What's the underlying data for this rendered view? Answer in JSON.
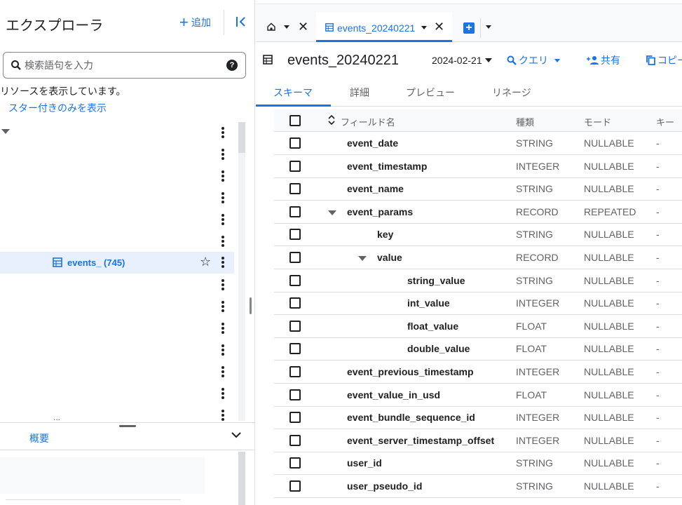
{
  "explorer": {
    "title": "エクスプローラ",
    "add_label": "追加",
    "search_placeholder": "検索語句を入力",
    "resource_note": "リソースを表示しています。",
    "starred_link": "スター付きのみを表示",
    "selected_item": "events_ (745)",
    "tree_ellipsis": "...",
    "summary_label": "概要"
  },
  "tabs": {
    "active_label": "events_20240221"
  },
  "table": {
    "title": "events_20240221",
    "date": "2024-02-21",
    "query_label": "クエリ",
    "share_label": "共有",
    "copy_label": "コピー"
  },
  "subtabs": [
    "スキーマ",
    "詳細",
    "プレビュー",
    "リネージ"
  ],
  "schema_headers": {
    "field_name": "フィールド名",
    "type": "種類",
    "mode": "モード",
    "key": "キー"
  },
  "schema_rows": [
    {
      "name": "event_date",
      "type": "STRING",
      "mode": "NULLABLE",
      "key": "-"
    },
    {
      "name": "event_timestamp",
      "type": "INTEGER",
      "mode": "NULLABLE",
      "key": "-"
    },
    {
      "name": "event_name",
      "type": "STRING",
      "mode": "NULLABLE",
      "key": "-"
    },
    {
      "name": "event_params",
      "type": "RECORD",
      "mode": "REPEATED",
      "key": "-"
    },
    {
      "name": "key",
      "type": "STRING",
      "mode": "NULLABLE",
      "key": "-"
    },
    {
      "name": "value",
      "type": "RECORD",
      "mode": "NULLABLE",
      "key": "-"
    },
    {
      "name": "string_value",
      "type": "STRING",
      "mode": "NULLABLE",
      "key": "-"
    },
    {
      "name": "int_value",
      "type": "INTEGER",
      "mode": "NULLABLE",
      "key": "-"
    },
    {
      "name": "float_value",
      "type": "FLOAT",
      "mode": "NULLABLE",
      "key": "-"
    },
    {
      "name": "double_value",
      "type": "FLOAT",
      "mode": "NULLABLE",
      "key": "-"
    },
    {
      "name": "event_previous_timestamp",
      "type": "INTEGER",
      "mode": "NULLABLE",
      "key": "-"
    },
    {
      "name": "event_value_in_usd",
      "type": "FLOAT",
      "mode": "NULLABLE",
      "key": "-"
    },
    {
      "name": "event_bundle_sequence_id",
      "type": "INTEGER",
      "mode": "NULLABLE",
      "key": "-"
    },
    {
      "name": "event_server_timestamp_offset",
      "type": "INTEGER",
      "mode": "NULLABLE",
      "key": "-"
    },
    {
      "name": "user_id",
      "type": "STRING",
      "mode": "NULLABLE",
      "key": "-"
    },
    {
      "name": "user_pseudo_id",
      "type": "STRING",
      "mode": "NULLABLE",
      "key": "-"
    }
  ]
}
